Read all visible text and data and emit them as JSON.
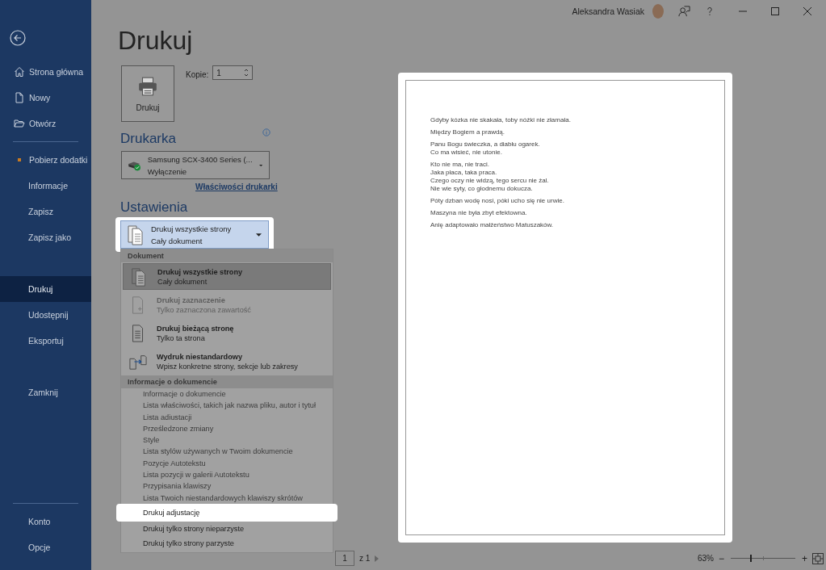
{
  "title_bar": {
    "user_name": "Aleksandra Wasiak"
  },
  "sidebar": {
    "items": [
      {
        "label": "Strona główna",
        "kind": "icon",
        "selected": false
      },
      {
        "label": "Nowy",
        "kind": "icon",
        "selected": false
      },
      {
        "label": "Otwórz",
        "kind": "icon",
        "selected": false
      },
      {
        "kind": "divider"
      },
      {
        "label": "Pobierz dodatki",
        "kind": "dot",
        "selected": false
      },
      {
        "label": "Informacje",
        "kind": "plain",
        "selected": false
      },
      {
        "label": "Zapisz",
        "kind": "plain",
        "selected": false
      },
      {
        "label": "Zapisz jako",
        "kind": "plain",
        "selected": false
      },
      {
        "kind": "gap"
      },
      {
        "label": "Drukuj",
        "kind": "plain",
        "selected": true
      },
      {
        "label": "Udostępnij",
        "kind": "plain",
        "selected": false
      },
      {
        "label": "Eksportuj",
        "kind": "plain",
        "selected": false
      },
      {
        "kind": "gap"
      },
      {
        "label": "Zamknij",
        "kind": "plain",
        "selected": false
      }
    ],
    "footer_items": [
      {
        "label": "Konto",
        "selected": false
      },
      {
        "label": "Opcje",
        "selected": false
      }
    ]
  },
  "page_title": "Drukuj",
  "print_button": {
    "label": "Drukuj"
  },
  "copies": {
    "label": "Kopie:",
    "value": "1"
  },
  "printer": {
    "heading": "Drukarka",
    "name": "Samsung SCX-3400 Series (...",
    "status": "Wyłączenie",
    "properties_link": "Właściwości drukarki"
  },
  "settings": {
    "heading": "Ustawienia",
    "dropdown": {
      "title": "Drukuj wszystkie strony",
      "subtitle": "Cały dokument",
      "highlighted": true
    }
  },
  "menu": [
    {
      "kind": "header",
      "label": "Dokument"
    },
    {
      "kind": "option",
      "title": "Drukuj wszystkie strony",
      "subtitle": "Cały dokument",
      "selected": true,
      "disabled": false
    },
    {
      "kind": "option",
      "title": "Drukuj zaznaczenie",
      "subtitle": "Tylko zaznaczona zawartość",
      "selected": false,
      "disabled": true
    },
    {
      "kind": "option",
      "title": "Drukuj bieżącą stronę",
      "subtitle": "Tylko ta strona",
      "selected": false,
      "disabled": false
    },
    {
      "kind": "option",
      "title": "Wydruk niestandardowy",
      "subtitle": "Wpisz konkretne strony, sekcje lub zakresy",
      "selected": false,
      "disabled": false
    },
    {
      "kind": "header",
      "label": "Informacje o dokumencie"
    },
    {
      "kind": "info",
      "title": "Informacje o dokumencie",
      "subtitle": "Lista właściwości, takich jak nazwa pliku, autor i tytuł"
    },
    {
      "kind": "info",
      "title": "Lista adiustacji",
      "subtitle": "Prześledzone zmiany"
    },
    {
      "kind": "info",
      "title": "Style",
      "subtitle": "Lista stylów używanych w Twoim dokumencie"
    },
    {
      "kind": "info",
      "title": "Pozycje Autotekstu",
      "subtitle": "Lista pozycji w galerii Autotekstu"
    },
    {
      "kind": "info",
      "title": "Przypisania klawiszy",
      "subtitle": "Lista Twoich niestandardowych klawiszy skrótów"
    },
    {
      "kind": "toggle",
      "label": "Drukuj adjustację",
      "highlighted": true
    },
    {
      "kind": "toggle",
      "label": "Drukuj tylko strony nieparzyste",
      "highlighted": false
    },
    {
      "kind": "toggle",
      "label": "Drukuj tylko strony parzyste",
      "highlighted": false
    }
  ],
  "preview": {
    "paragraphs": [
      [
        "Gdyby kózka nie skakała, toby nóżki nie złamała."
      ],
      [
        "Między Bogiem a prawdą."
      ],
      [
        "Panu Bogu świeczka, a diabłu ogarek.",
        "Co ma wisieć, nie utonie."
      ],
      [
        "Kto nie ma, nie traci.",
        "Jaka płaca, taka praca.",
        "Czego oczy nie widzą, tego sercu nie żal.",
        "Nie wie syty, co głodnemu dokucza."
      ],
      [
        "Póty dzban wodę nosi, póki ucho się nie urwie."
      ],
      [
        "Maszyna nie była zbyt efektowna."
      ],
      [
        "Anię adaptowało małżeństwo Matuszaków."
      ]
    ]
  },
  "page_nav": {
    "page": "1",
    "of": "z 1"
  },
  "zoom": {
    "percent": "63%",
    "minus": "−",
    "plus": "+",
    "level": 0.31
  }
}
